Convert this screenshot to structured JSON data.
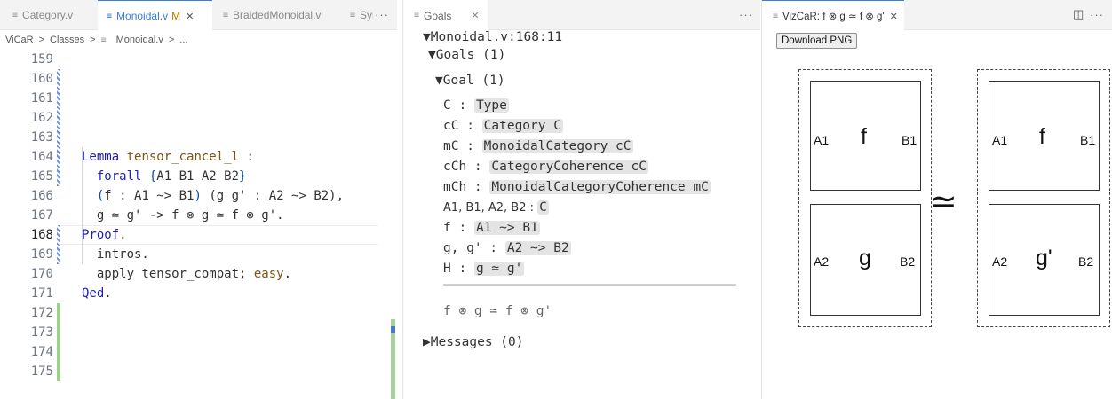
{
  "editor": {
    "tabs": [
      {
        "label": "Category.v"
      },
      {
        "label": "Monoidal.v",
        "badge": "M"
      },
      {
        "label": "BraidedMonoidal.v"
      },
      {
        "label": "Syr"
      }
    ],
    "more": "···",
    "breadcrumb": [
      "ViCaR",
      ">",
      "Classes",
      ">",
      "Monoidal.v",
      ">",
      "..."
    ],
    "lines": [
      {
        "n": "159",
        "t": ""
      },
      {
        "n": "160",
        "t": ""
      },
      {
        "n": "161",
        "t": ""
      },
      {
        "n": "162",
        "t": ""
      },
      {
        "n": "163",
        "kw": "Lemma",
        "nm": "tensor_cancel_l",
        "t": " :"
      },
      {
        "n": "164",
        "a": "  forall ",
        "b": "{",
        "c": "A1 B1 A2 B2",
        "d": "}"
      },
      {
        "n": "165",
        "a": "  ",
        "b": "(",
        "c": "f : A1 ~> B1",
        "d": ")",
        "e": " (g g' : A2 ~> B2),"
      },
      {
        "n": "166",
        "t": "  g ≃ g' -> f ⊗ g ≃ f ⊗ g'."
      },
      {
        "n": "167",
        "kw": "Proof",
        "t": "."
      },
      {
        "n": "168",
        "t": "  intros."
      },
      {
        "n": "169",
        "a": "  apply tensor_compat; ",
        "nm": "easy",
        "t": "."
      },
      {
        "n": "170",
        "kw": "Qed",
        "t": "."
      },
      {
        "n": "171",
        "t": ""
      },
      {
        "n": "172",
        "t": ""
      },
      {
        "n": "173",
        "t": ""
      },
      {
        "n": "174",
        "t": ""
      },
      {
        "n": "175",
        "t": ""
      }
    ]
  },
  "goals": {
    "tab_label": "Goals",
    "more": "···",
    "header": "▼Monoidal.v:168:11",
    "goals_header": "▼Goals (1)",
    "goal_header": "▼Goal (1)",
    "hyps": [
      {
        "name": "C :",
        "type": "Type"
      },
      {
        "name": "cC :",
        "type": "Category C"
      },
      {
        "name": "mC :",
        "type": "MonoidalCategory cC"
      },
      {
        "name": "cCh :",
        "type": "CategoryCoherence cC"
      },
      {
        "name": "mCh :",
        "type": "MonoidalCategoryCoherence mC"
      },
      {
        "name": "A1, B1, A2, B2 :",
        "type": "C"
      },
      {
        "name": "f :",
        "type": "A1 ~> B1"
      },
      {
        "name": "g, g' :",
        "type": "A2 ~> B2"
      },
      {
        "name": "H :",
        "type": "g ≃ g'"
      }
    ],
    "conclusion": "f ⊗ g ≃ f ⊗ g'",
    "messages": "▶Messages (0)"
  },
  "viz": {
    "tab_label": "VizCaR: f ⊗ g ≃ f ⊗ g'",
    "download_label": "Download PNG",
    "more": "···",
    "left": {
      "top": {
        "in": "A1",
        "mid": "f",
        "out": "B1"
      },
      "bottom": {
        "in": "A2",
        "mid": "g",
        "out": "B2"
      }
    },
    "right": {
      "top": {
        "in": "A1",
        "mid": "f",
        "out": "B1"
      },
      "bottom": {
        "in": "A2",
        "mid": "g'",
        "out": "B2"
      }
    },
    "relation": "≃"
  }
}
